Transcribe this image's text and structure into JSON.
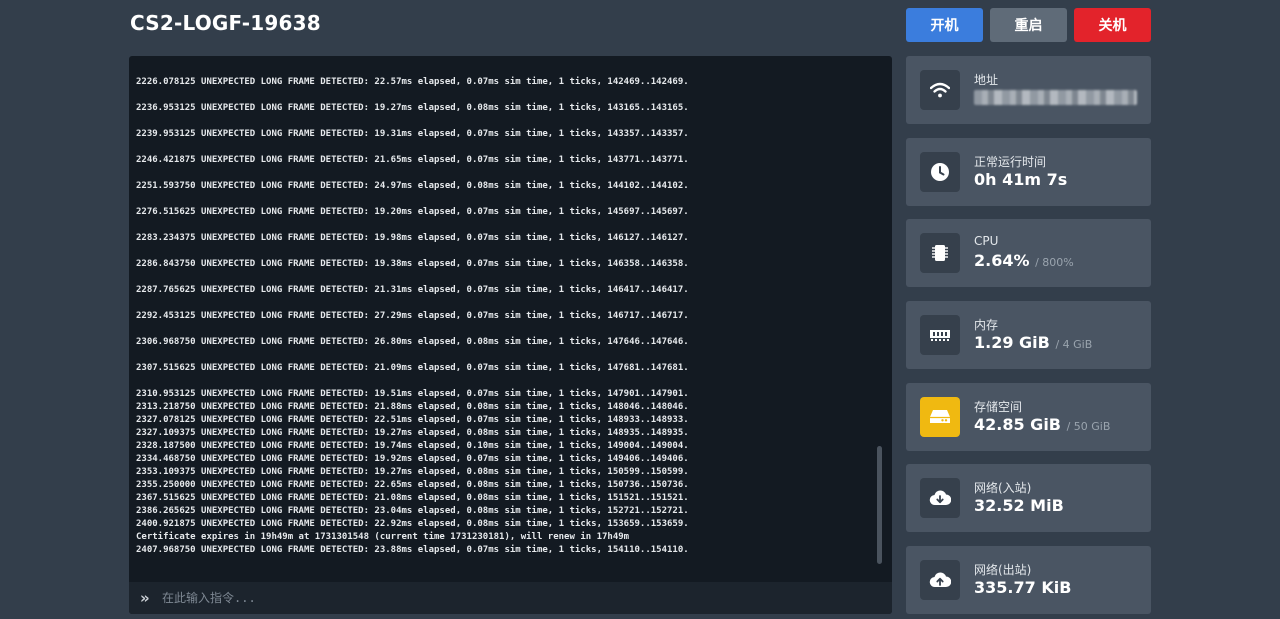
{
  "server": {
    "name": "CS2-LOGF-19638"
  },
  "power": {
    "start": "开机",
    "restart": "重启",
    "stop": "关机"
  },
  "console": {
    "lines_spaced": [
      "2226.078125 UNEXPECTED LONG FRAME DETECTED: 22.57ms elapsed, 0.07ms sim time, 1 ticks, 142469..142469.",
      "2236.953125 UNEXPECTED LONG FRAME DETECTED: 19.27ms elapsed, 0.08ms sim time, 1 ticks, 143165..143165.",
      "2239.953125 UNEXPECTED LONG FRAME DETECTED: 19.31ms elapsed, 0.07ms sim time, 1 ticks, 143357..143357.",
      "2246.421875 UNEXPECTED LONG FRAME DETECTED: 21.65ms elapsed, 0.07ms sim time, 1 ticks, 143771..143771.",
      "2251.593750 UNEXPECTED LONG FRAME DETECTED: 24.97ms elapsed, 0.08ms sim time, 1 ticks, 144102..144102.",
      "2276.515625 UNEXPECTED LONG FRAME DETECTED: 19.20ms elapsed, 0.07ms sim time, 1 ticks, 145697..145697.",
      "2283.234375 UNEXPECTED LONG FRAME DETECTED: 19.98ms elapsed, 0.07ms sim time, 1 ticks, 146127..146127.",
      "2286.843750 UNEXPECTED LONG FRAME DETECTED: 19.38ms elapsed, 0.07ms sim time, 1 ticks, 146358..146358.",
      "2287.765625 UNEXPECTED LONG FRAME DETECTED: 21.31ms elapsed, 0.07ms sim time, 1 ticks, 146417..146417.",
      "2292.453125 UNEXPECTED LONG FRAME DETECTED: 27.29ms elapsed, 0.07ms sim time, 1 ticks, 146717..146717.",
      "2306.968750 UNEXPECTED LONG FRAME DETECTED: 26.80ms elapsed, 0.08ms sim time, 1 ticks, 147646..147646.",
      "2307.515625 UNEXPECTED LONG FRAME DETECTED: 21.09ms elapsed, 0.07ms sim time, 1 ticks, 147681..147681."
    ],
    "lines_dense": [
      "2310.953125 UNEXPECTED LONG FRAME DETECTED: 19.51ms elapsed, 0.07ms sim time, 1 ticks, 147901..147901.",
      "2313.218750 UNEXPECTED LONG FRAME DETECTED: 21.88ms elapsed, 0.08ms sim time, 1 ticks, 148046..148046.",
      "2327.078125 UNEXPECTED LONG FRAME DETECTED: 22.51ms elapsed, 0.07ms sim time, 1 ticks, 148933..148933.",
      "2327.109375 UNEXPECTED LONG FRAME DETECTED: 19.27ms elapsed, 0.08ms sim time, 1 ticks, 148935..148935.",
      "2328.187500 UNEXPECTED LONG FRAME DETECTED: 19.74ms elapsed, 0.10ms sim time, 1 ticks, 149004..149004.",
      "2334.468750 UNEXPECTED LONG FRAME DETECTED: 19.92ms elapsed, 0.07ms sim time, 1 ticks, 149406..149406.",
      "2353.109375 UNEXPECTED LONG FRAME DETECTED: 19.27ms elapsed, 0.08ms sim time, 1 ticks, 150599..150599.",
      "2355.250000 UNEXPECTED LONG FRAME DETECTED: 22.65ms elapsed, 0.08ms sim time, 1 ticks, 150736..150736.",
      "2367.515625 UNEXPECTED LONG FRAME DETECTED: 21.08ms elapsed, 0.08ms sim time, 1 ticks, 151521..151521.",
      "2386.265625 UNEXPECTED LONG FRAME DETECTED: 23.04ms elapsed, 0.08ms sim time, 1 ticks, 152721..152721.",
      "2400.921875 UNEXPECTED LONG FRAME DETECTED: 22.92ms elapsed, 0.08ms sim time, 1 ticks, 153659..153659.",
      "Certificate expires in 19h49m at 1731301548 (current time 1731230181), will renew in 17h49m",
      "2407.968750 UNEXPECTED LONG FRAME DETECTED: 23.88ms elapsed, 0.07ms sim time, 1 ticks, 154110..154110."
    ],
    "input_placeholder": "在此输入指令...",
    "prompt_glyph": "»"
  },
  "stats": {
    "address": {
      "label": "地址",
      "icon": "wifi-icon"
    },
    "uptime": {
      "label": "正常运行时间",
      "value": "0h 41m 7s",
      "icon": "clock-icon"
    },
    "cpu": {
      "label": "CPU",
      "value": "2.64%",
      "limit": "/ 800%",
      "icon": "cpu-chip-icon"
    },
    "memory": {
      "label": "内存",
      "value": "1.29 GiB",
      "limit": "/ 4 GiB",
      "icon": "memory-icon"
    },
    "disk": {
      "label": "存储空间",
      "value": "42.85 GiB",
      "limit": "/ 50 GiB",
      "icon": "hard-drive-icon",
      "accent": "#f0b911"
    },
    "net_in": {
      "label": "网络(入站)",
      "value": "32.52 MiB",
      "icon": "cloud-download-icon"
    },
    "net_out": {
      "label": "网络(出站)",
      "value": "335.77 KiB",
      "icon": "cloud-upload-icon"
    }
  },
  "colors": {
    "start": "#3b7ddd",
    "restart": "#5f6b78",
    "stop": "#e3232b",
    "background": "#333e4b",
    "card": "#4a5563",
    "console": "#131a22"
  }
}
